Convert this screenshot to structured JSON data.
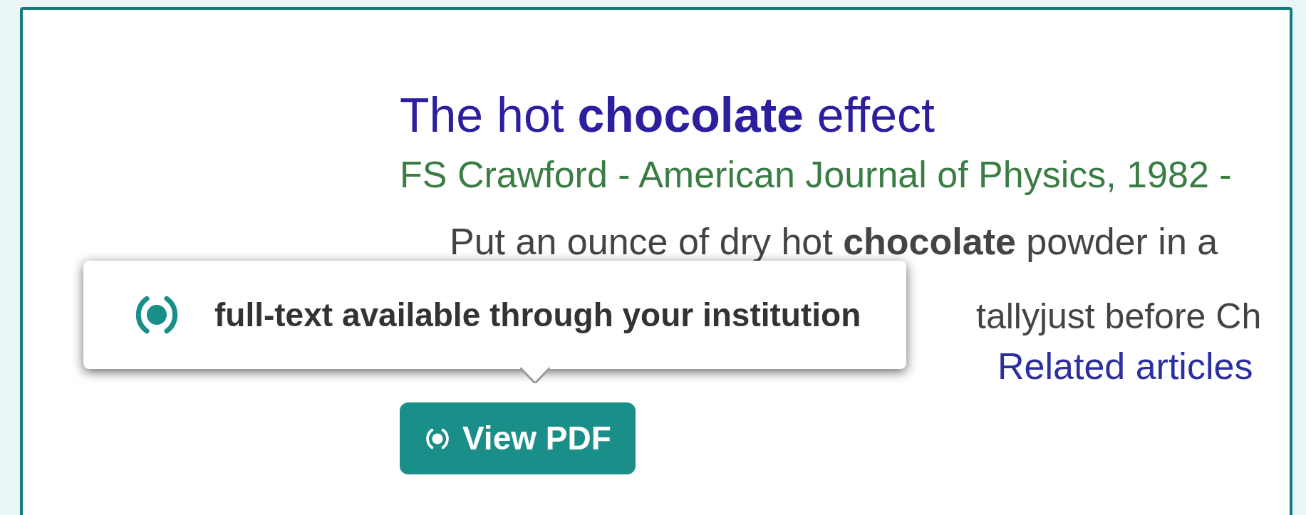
{
  "result": {
    "title": "The hot **chocolate** effect",
    "authors": "FS Crawford - American Journal of Physics, 1982 -",
    "snippet_lines": [
      "Put an ounce of dry hot **chocolate** powder in a",
      "tallyjust before Ch"
    ],
    "links": [
      "Related articles"
    ]
  },
  "tooltip": {
    "text": "full-text available through your institution"
  },
  "pdf_button": {
    "label": "View PDF"
  }
}
